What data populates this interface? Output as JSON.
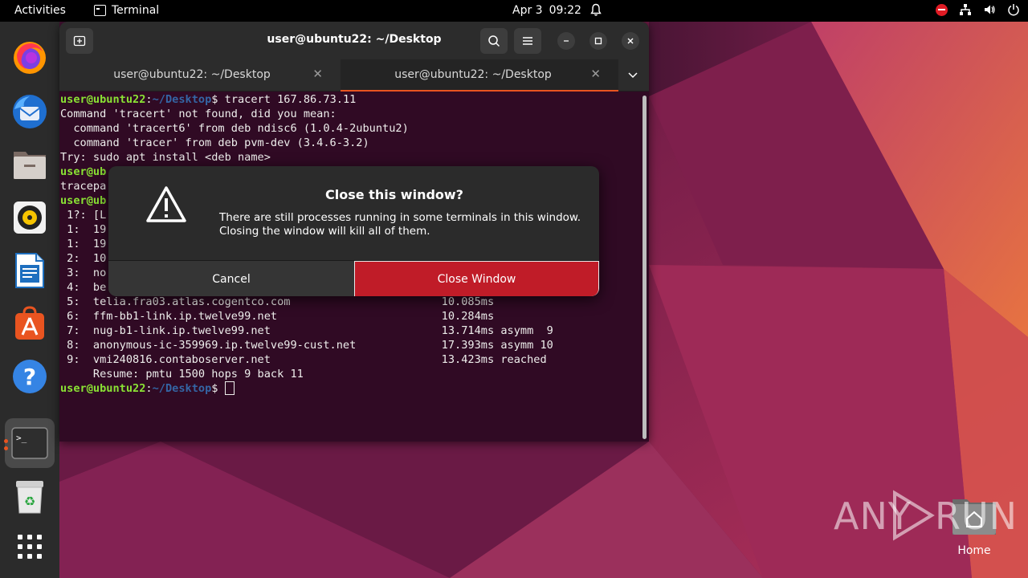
{
  "topbar": {
    "activities": "Activities",
    "app_name": "Terminal",
    "date": "Apr 3",
    "time": "09:22"
  },
  "dock": {
    "items": [
      "firefox-icon",
      "thunderbird-icon",
      "files-icon",
      "rhythmbox-icon",
      "libreoffice-writer-icon",
      "app-center-icon",
      "help-icon",
      "terminal-icon",
      "trash-icon",
      "show-apps-icon"
    ]
  },
  "terminal": {
    "window_title": "user@ubuntu22: ~/Desktop",
    "tabs": [
      {
        "label": "user@ubuntu22: ~/Desktop"
      },
      {
        "label": "user@ubuntu22: ~/Desktop"
      }
    ],
    "prompt_user": "user@ubuntu22",
    "prompt_path": "~/Desktop",
    "lines": [
      {
        "type": "prompt",
        "cmd": "$ tracert 167.86.73.11"
      },
      {
        "type": "out",
        "text": "Command 'tracert' not found, did you mean:"
      },
      {
        "type": "out",
        "text": "  command 'tracert6' from deb ndisc6 (1.0.4-2ubuntu2)"
      },
      {
        "type": "out",
        "text": "  command 'tracer' from deb pvm-dev (3.4.6-3.2)"
      },
      {
        "type": "out",
        "text": "Try: sudo apt install <deb name>"
      },
      {
        "type": "prompt_partial",
        "text": "user@ub"
      },
      {
        "type": "out",
        "text": "tracepa"
      },
      {
        "type": "prompt_partial",
        "text": "user@ub"
      },
      {
        "type": "out",
        "text": " 1?: [L"
      },
      {
        "type": "out",
        "text": " 1:  19"
      },
      {
        "type": "out",
        "text": " 1:  19"
      },
      {
        "type": "out",
        "text": " 2:  10"
      },
      {
        "type": "out",
        "text": " 3:  no"
      },
      {
        "type": "out",
        "text": " 4:  be"
      },
      {
        "type": "out",
        "text": " 5:  telia.fra03.atlas.cogentco.com                       10.085ms"
      },
      {
        "type": "out",
        "text": " 6:  ffm-bb1-link.ip.twelve99.net                         10.284ms"
      },
      {
        "type": "out",
        "text": " 7:  nug-b1-link.ip.twelve99.net                          13.714ms asymm  9"
      },
      {
        "type": "out",
        "text": " 8:  anonymous-ic-359969.ip.twelve99-cust.net             17.393ms asymm 10"
      },
      {
        "type": "out",
        "text": " 9:  vmi240816.contaboserver.net                          13.423ms reached"
      },
      {
        "type": "out",
        "text": "     Resume: pmtu 1500 hops 9 back 11"
      },
      {
        "type": "prompt",
        "cmd": "$ "
      }
    ]
  },
  "dialog": {
    "title": "Close this window?",
    "message_line1": "There are still processes running in some terminals in this window.",
    "message_line2": "Closing the window will kill all of them.",
    "cancel_label": "Cancel",
    "confirm_label": "Close Window"
  },
  "desktop": {
    "home_label": "Home"
  },
  "watermark": {
    "text_left": "ANY",
    "text_right": "RUN"
  },
  "colors": {
    "terminal_bg": "#300a24",
    "accent": "#e95420",
    "destructive": "#c01c28",
    "prompt_user": "#8ae234",
    "prompt_path": "#3465a4"
  }
}
